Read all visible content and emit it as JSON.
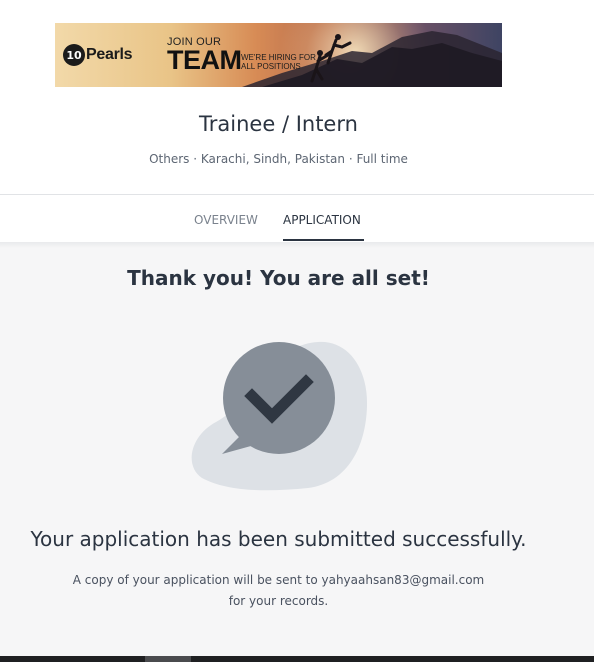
{
  "banner": {
    "logo_mark": "10",
    "logo_text": "Pearls",
    "join_text": "JOIN OUR",
    "team_text": "TEAM",
    "hiring_text": "WE'RE HIRING FOR ALL POSITIONS"
  },
  "job": {
    "title": "Trainee / Intern",
    "meta": "Others · Karachi, Sindh, Pakistan · Full time"
  },
  "tabs": [
    {
      "label": "OVERVIEW",
      "active": false
    },
    {
      "label": "APPLICATION",
      "active": true
    }
  ],
  "confirmation": {
    "heading": "Thank you! You are all set!",
    "message": "Your application has been submitted successfully.",
    "copy_line1": "A copy of your application will be sent to yahyaahsan83@gmail.com",
    "copy_line2": "for your records.",
    "icon": "check-chat-bubble-icon"
  },
  "colors": {
    "text_primary": "#2b3441",
    "text_secondary": "#5d6673",
    "tab_inactive": "#7a828d",
    "bubble_back": "#dde1e6",
    "bubble_front": "#868e98",
    "check": "#2f3742",
    "content_bg": "#f6f6f7"
  }
}
